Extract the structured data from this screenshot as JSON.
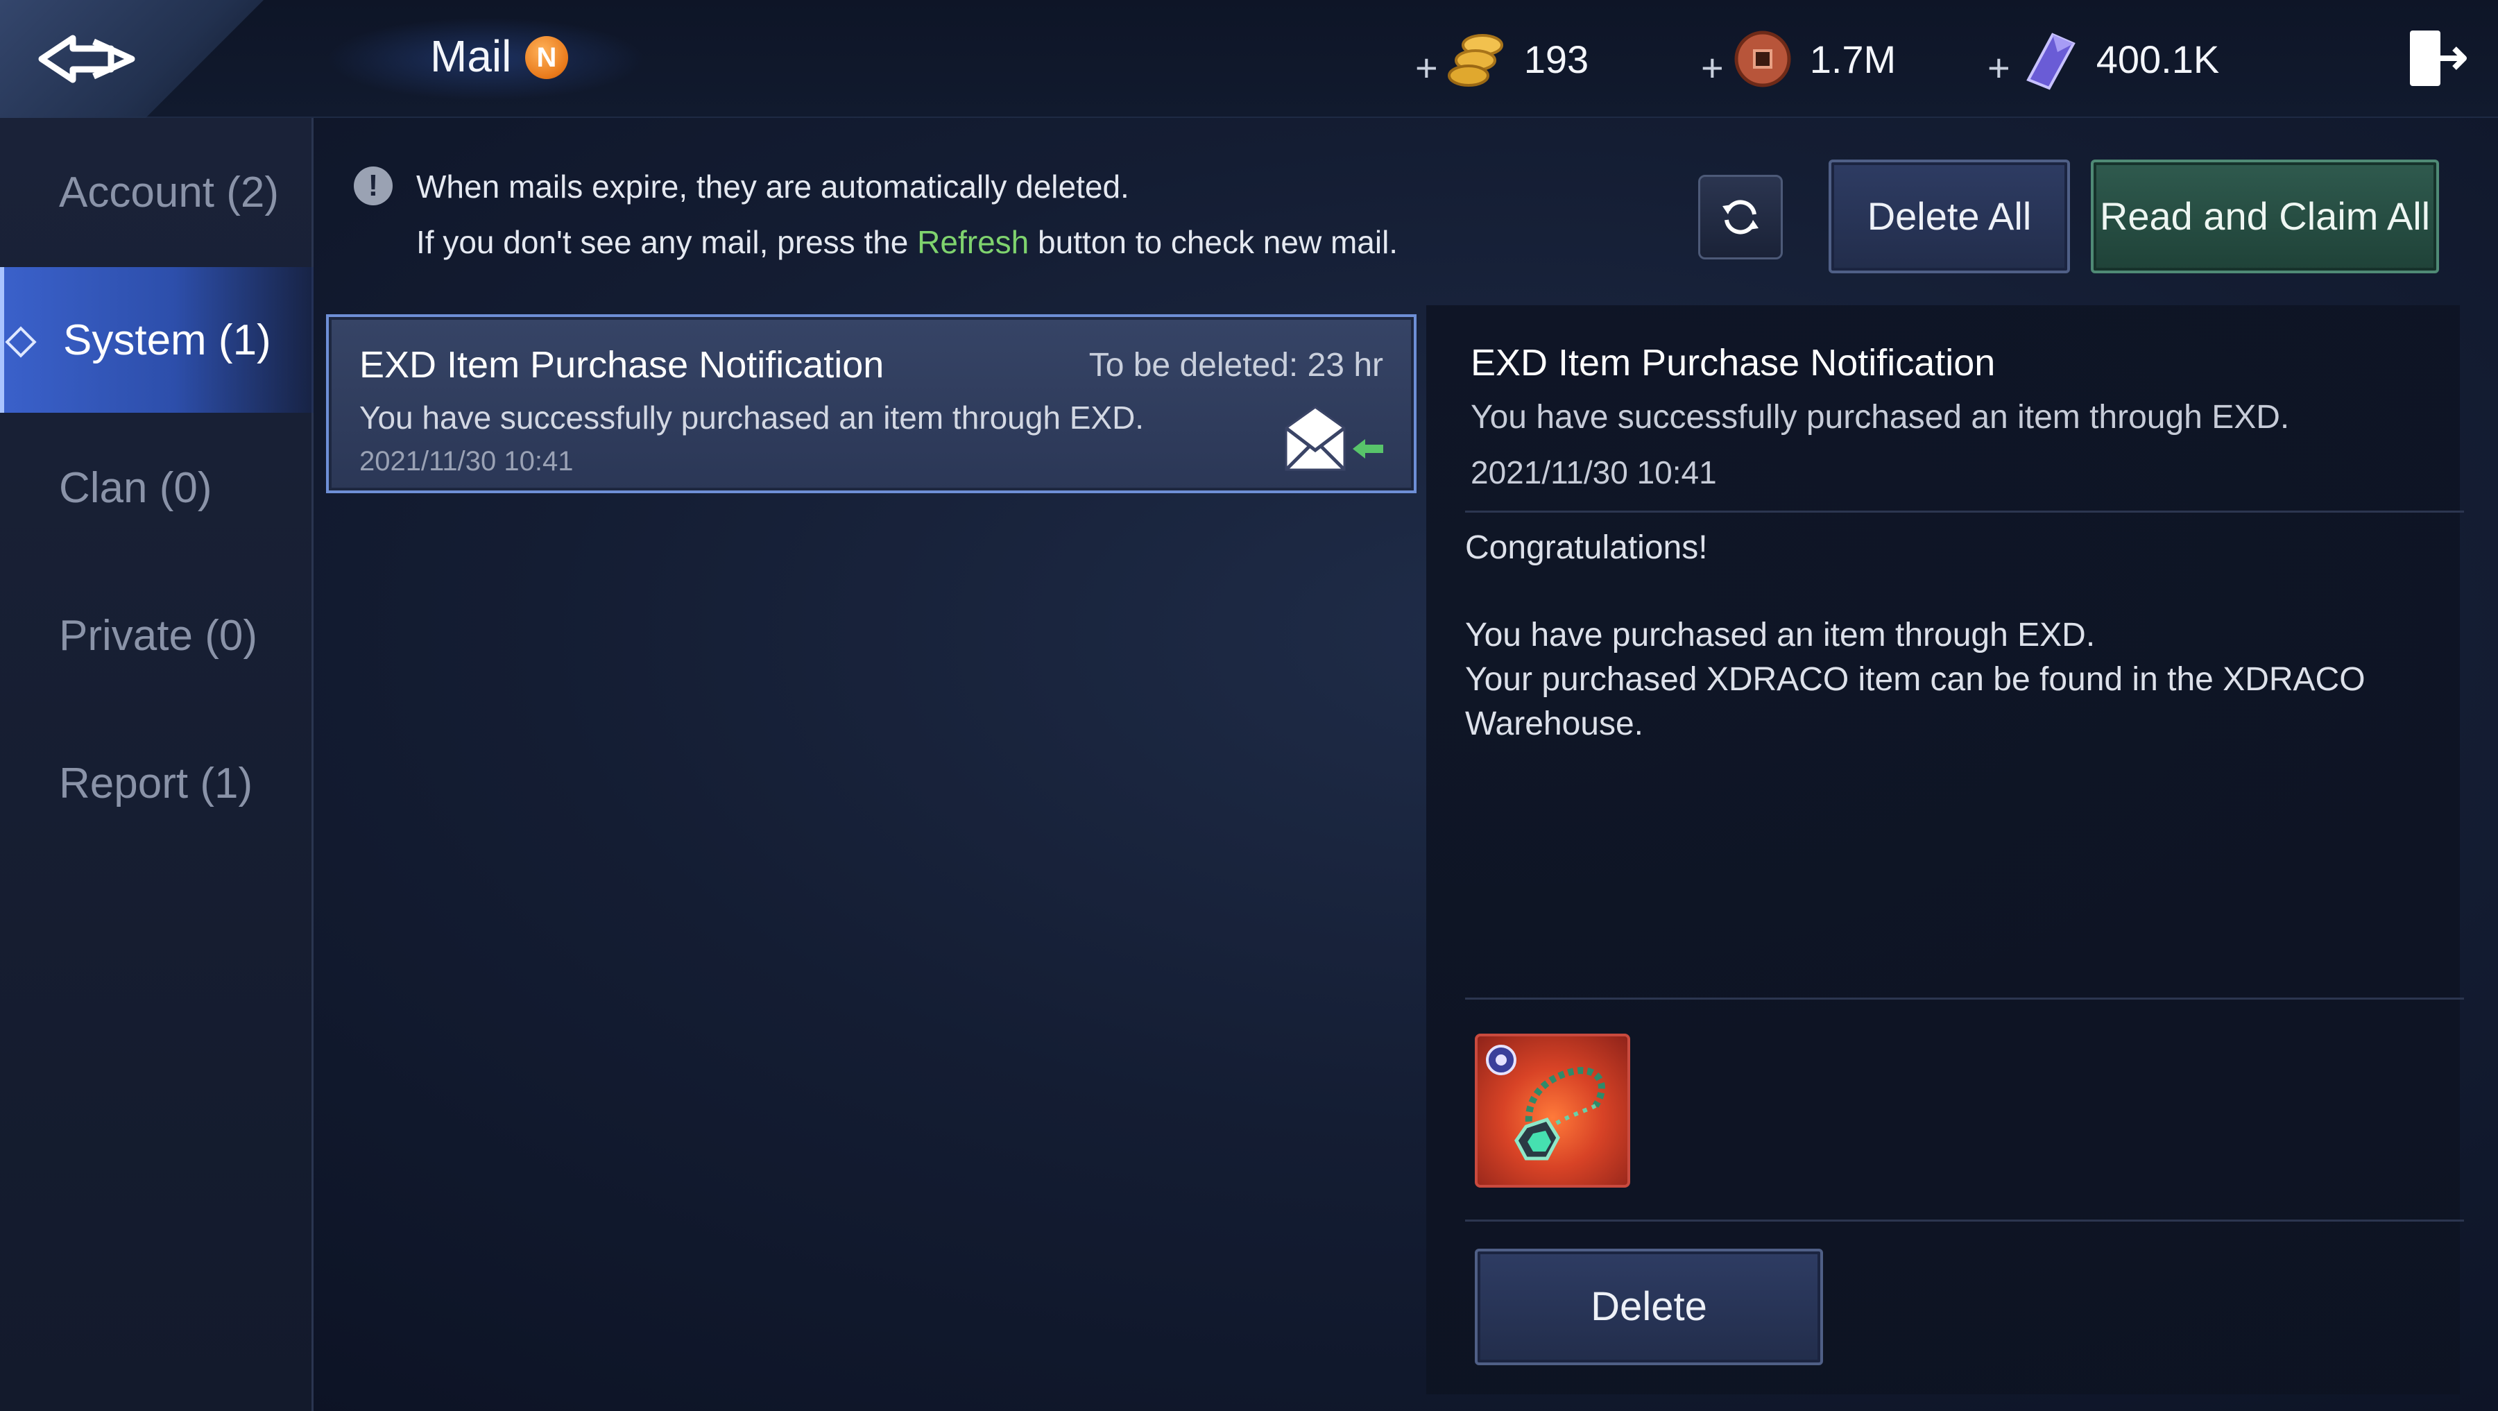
{
  "header": {
    "title": "Mail",
    "title_badge": "N",
    "back_icon": "back-arrow-icon",
    "exit_icon": "exit-door-icon",
    "currencies": [
      {
        "name": "gold",
        "icon": "gold-coins-icon",
        "plus": "+",
        "amount": "193"
      },
      {
        "name": "copper",
        "icon": "copper-coin-icon",
        "plus": "+",
        "amount": "1.7M"
      },
      {
        "name": "crystal",
        "icon": "purple-crystal-icon",
        "plus": "+",
        "amount": "400.1K"
      }
    ]
  },
  "sidebar": {
    "items": [
      {
        "label": "Account (2)",
        "active": false
      },
      {
        "label": "System (1)",
        "active": true
      },
      {
        "label": "Clan (0)",
        "active": false
      },
      {
        "label": "Private (0)",
        "active": false
      },
      {
        "label": "Report (1)",
        "active": false
      }
    ]
  },
  "notice": {
    "icon_glyph": "!",
    "line1": "When mails expire, they are automatically deleted.",
    "line2_before": "If you don't see any mail, press the ",
    "line2_highlight": "Refresh",
    "line2_after": " button to check new mail."
  },
  "actions": {
    "refresh_icon": "refresh-icon",
    "delete_all_label": "Delete All",
    "claim_all_label": "Read and Claim All"
  },
  "mail_list": [
    {
      "title": "EXD Item Purchase Notification",
      "expire": "To be deleted: 23 hr",
      "summary": "You have successfully purchased an item through EXD.",
      "date": "2021/11/30 10:41",
      "status_icon": "open-envelope-icon"
    }
  ],
  "detail": {
    "title": "EXD Item Purchase Notification",
    "summary": "You have successfully purchased an item through EXD.",
    "date": "2021/11/30 10:41",
    "body": [
      "Congratulations!",
      "You have purchased an item through EXD.",
      "Your purchased XDRACO item can be found in the XDRACO",
      "Warehouse."
    ],
    "attachment_icon": "jade-necklace-icon",
    "delete_label": "Delete"
  },
  "colors": {
    "accent_blue": "#6e8fd6",
    "highlight_green": "#7fd36e",
    "badge_orange": "#e8791a",
    "item_red": "#d84326"
  }
}
